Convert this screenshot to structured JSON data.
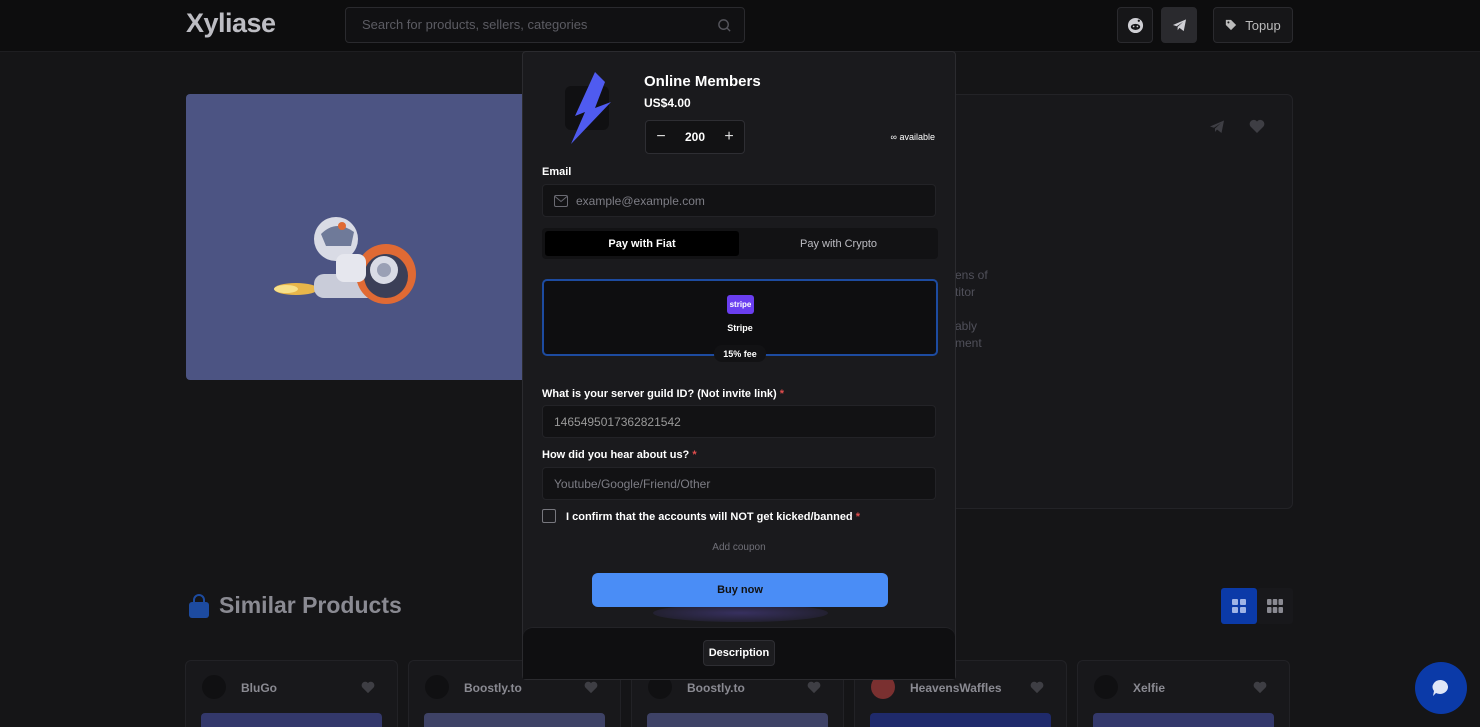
{
  "header": {
    "logo": "Xyliase",
    "search_placeholder": "Search for products, sellers, categories",
    "topup_label": "Topup"
  },
  "background": {
    "info_fragments": [
      "ens of",
      "titor",
      "ably",
      "ment"
    ],
    "similar_title": "Similar Products",
    "products": [
      {
        "name": "BluGo"
      },
      {
        "name": "Boostly.to"
      },
      {
        "name": "Boostly.to"
      },
      {
        "name": "HeavensWaffles"
      },
      {
        "name": "Xelfie"
      }
    ]
  },
  "modal": {
    "title": "Online Members",
    "price": "US$4.00",
    "quantity": "200",
    "quantity_minus": "−",
    "quantity_plus": "+",
    "availability": "∞ available",
    "email_label": "Email",
    "email_placeholder": "example@example.com",
    "pay_tabs": [
      "Pay with Fiat",
      "Pay with Crypto"
    ],
    "active_pay_tab": 0,
    "payment_method": "Stripe",
    "payment_logo_text": "stripe",
    "fee": "15% fee",
    "guild_label": "What is your server guild ID? (Not invite link)",
    "guild_value": "1465495017362821542",
    "hear_label": "How did you hear about us?",
    "hear_placeholder": "Youtube/Google/Friend/Other",
    "required_mark": "*",
    "confirm_label": "I confirm that the accounts will NOT get kicked/banned",
    "confirm_checked": false,
    "coupon_label": "Add coupon",
    "buy_label": "Buy now",
    "description_label": "Description"
  },
  "colors": {
    "accent": "#4a8df6",
    "selected_border": "#1d4ba0",
    "brand_purple": "#6a3ef0",
    "required": "#e14d4d"
  }
}
